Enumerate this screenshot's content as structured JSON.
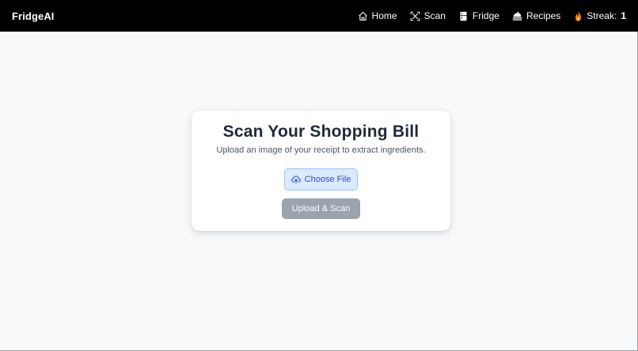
{
  "navbar": {
    "brand": "FridgeAI",
    "links": [
      {
        "label": "Home",
        "icon": "home-icon"
      },
      {
        "label": "Scan",
        "icon": "scan-icon"
      },
      {
        "label": "Fridge",
        "icon": "fridge-icon"
      },
      {
        "label": "Recipes",
        "icon": "recipes-icon"
      }
    ],
    "streak": {
      "label": "Streak:",
      "count": "1",
      "icon": "flame-icon"
    }
  },
  "card": {
    "title": "Scan Your Shopping Bill",
    "subtitle": "Upload an image of your receipt to extract ingredients.",
    "choose_file_label": "Choose File",
    "upload_label": "Upload & Scan"
  },
  "colors": {
    "navbar_bg": "#000000",
    "page_bg": "#f8f9fb",
    "choose_file_bg": "#dbeafe",
    "choose_file_text": "#1d4ed8",
    "upload_button_bg": "#9ca3af",
    "flame": "#f97316"
  }
}
